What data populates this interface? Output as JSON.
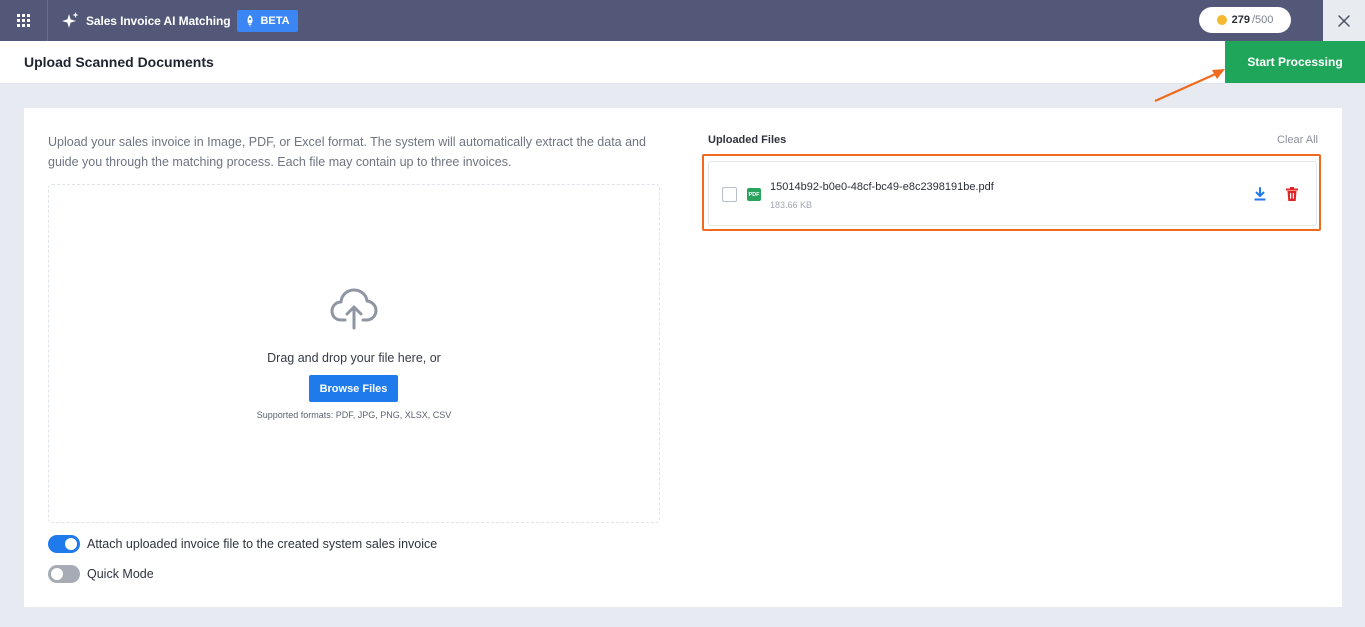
{
  "header": {
    "app_title": "Sales Invoice AI Matching",
    "beta_label": "BETA",
    "credits_used": "279",
    "credits_total": "/500"
  },
  "page": {
    "title": "Upload Scanned Documents",
    "start_button": "Start Processing"
  },
  "upload": {
    "intro": "Upload your sales invoice in Image, PDF, or Excel format. The system will automatically extract the data and guide you through the matching process. Each file may contain up to three invoices.",
    "drag_text": "Drag and drop your file here, or",
    "browse_button": "Browse Files",
    "formats": "Supported formats: PDF, JPG, PNG, XLSX, CSV"
  },
  "options": [
    {
      "label": "Attach uploaded invoice file to the created system sales invoice",
      "enabled": true
    },
    {
      "label": "Quick Mode",
      "enabled": false
    }
  ],
  "files_panel": {
    "title": "Uploaded Files",
    "clear_all": "Clear All",
    "files": [
      {
        "badge": "PDF",
        "name": "15014b92-b0e0-48cf-bc49-e8c2398191be.pdf",
        "size": "183.66 KB"
      }
    ]
  },
  "colors": {
    "topbar": "#535878",
    "accent": "#1f7aec",
    "success": "#20a65a",
    "danger": "#e02424",
    "highlight": "#f06a1e"
  },
  "icons": {
    "apps": "grid-icon",
    "sparkle": "sparkle-icon",
    "rocket": "rocket-icon",
    "coin": "coin-icon",
    "close": "close-icon",
    "upload": "cloud-upload-icon",
    "download": "download-icon",
    "delete": "trash-icon"
  }
}
